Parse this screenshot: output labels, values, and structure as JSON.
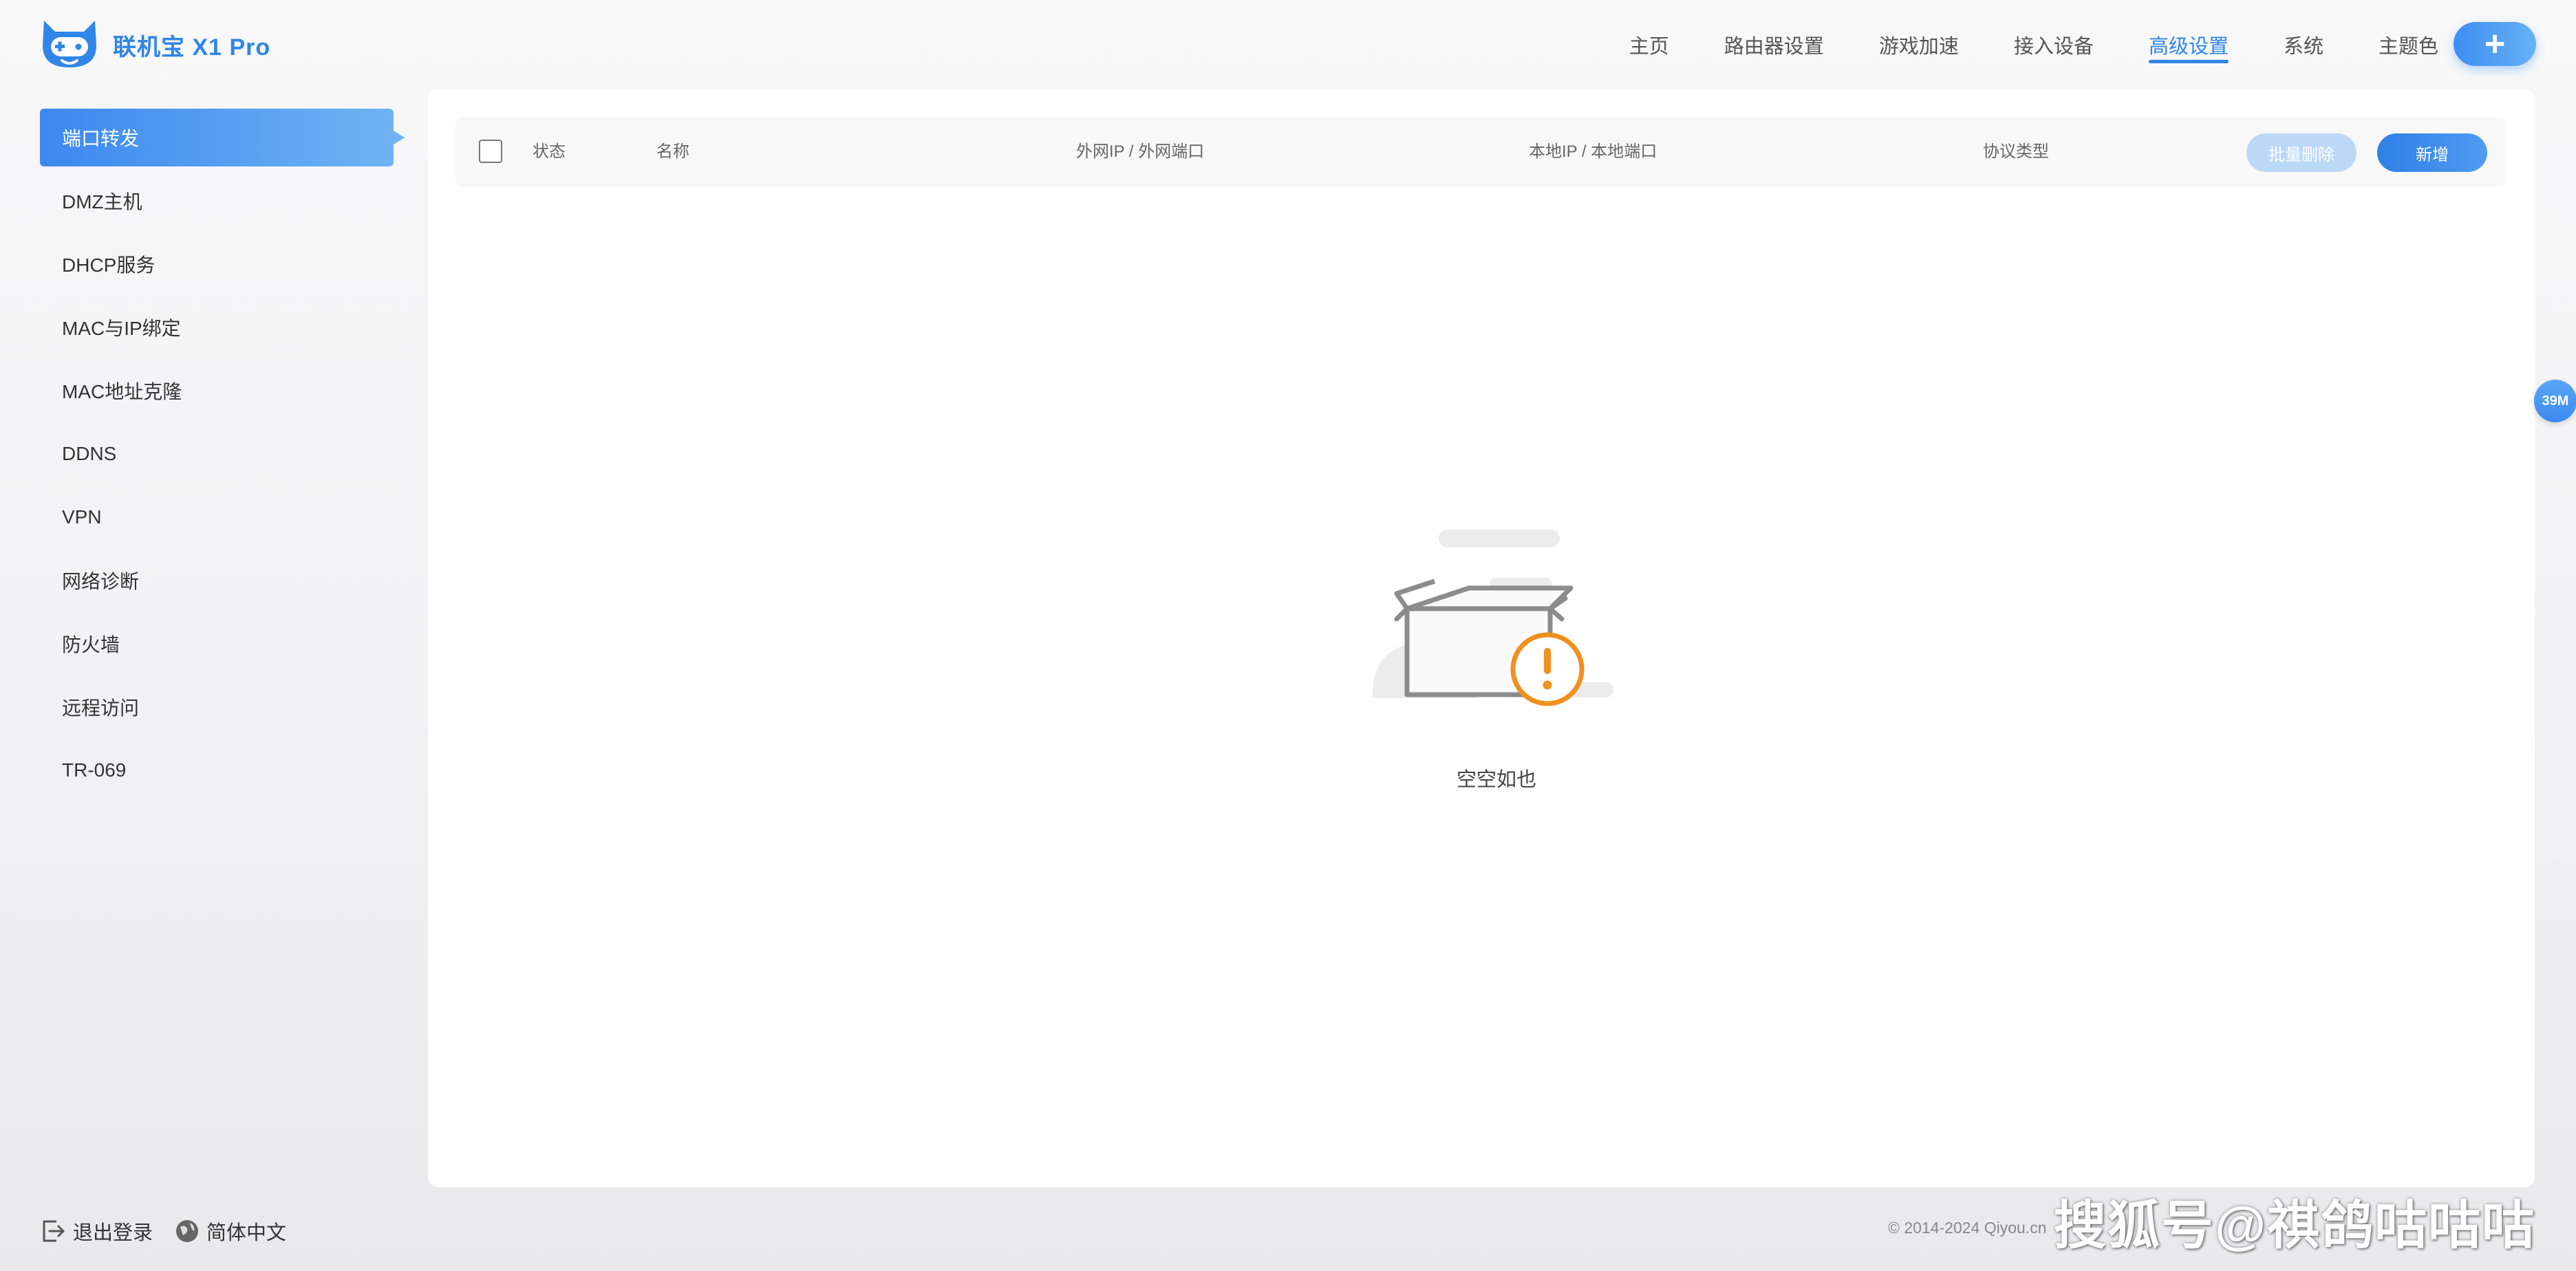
{
  "brand": {
    "name": "联机宝 X1 Pro",
    "logo": "cat-gamepad-logo"
  },
  "nav": [
    {
      "label": "主页"
    },
    {
      "label": "路由器设置"
    },
    {
      "label": "游戏加速"
    },
    {
      "label": "接入设备"
    },
    {
      "label": "高级设置",
      "active": true
    },
    {
      "label": "系统"
    },
    {
      "label": "主题色"
    }
  ],
  "add_button": {
    "label": "+"
  },
  "sidebar": {
    "items": [
      {
        "label": "端口转发",
        "active": true
      },
      {
        "label": "DMZ主机"
      },
      {
        "label": "DHCP服务"
      },
      {
        "label": "MAC与IP绑定"
      },
      {
        "label": "MAC地址克隆"
      },
      {
        "label": "DDNS"
      },
      {
        "label": "VPN"
      },
      {
        "label": "网络诊断"
      },
      {
        "label": "防火墙"
      },
      {
        "label": "远程访问"
      },
      {
        "label": "TR-069"
      }
    ]
  },
  "table": {
    "columns": [
      "状态",
      "名称",
      "外网IP / 外网端口",
      "本地IP / 本地端口",
      "协议类型"
    ],
    "batch_delete_label": "批量删除",
    "new_label": "新增",
    "empty_text": "空空如也"
  },
  "float_badge": "39M",
  "footer": {
    "logout": "退出登录",
    "language": "简体中文",
    "copyright": "© 2014-2024 Qiyou.cn"
  },
  "watermark": "搜狐号@祺鸽咕咕咕",
  "colors": {
    "accent": "#2f86e8",
    "warning": "#f0901e"
  }
}
